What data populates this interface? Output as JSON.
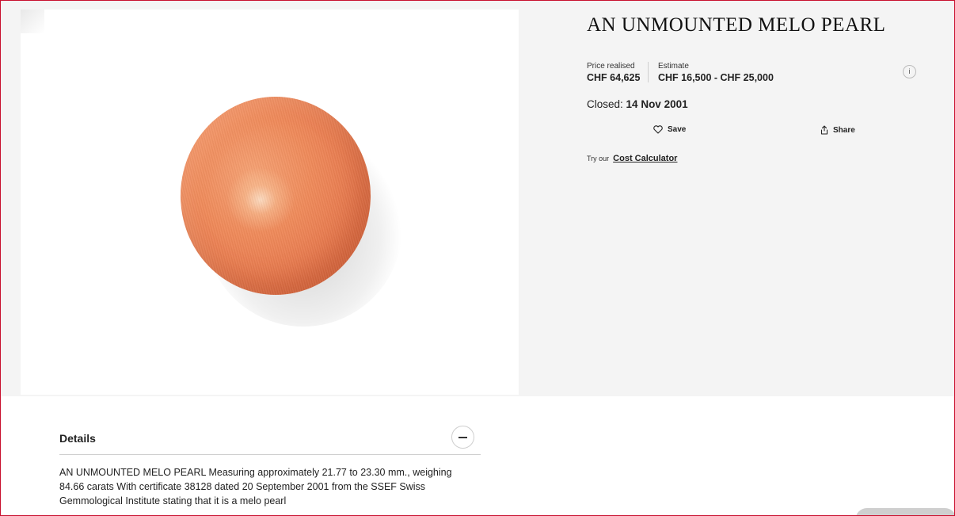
{
  "lot": {
    "title": "AN UNMOUNTED MELO PEARL",
    "image_alt": "Orange melo pearl on white background"
  },
  "pricing": {
    "price_label": "Price realised",
    "price_value": "CHF 64,625",
    "estimate_label": "Estimate",
    "estimate_value": "CHF 16,500 - CHF 25,000",
    "info_label": "i"
  },
  "status": {
    "closed_label": "Closed:",
    "closed_date": "14 Nov 2001"
  },
  "actions": {
    "save_label": "Save",
    "share_label": "Share",
    "save_icon": "heart-icon",
    "share_icon": "share-icon"
  },
  "calculator": {
    "prefix": "Try our",
    "link_label": "Cost Calculator"
  },
  "details": {
    "heading": "Details",
    "body": "AN UNMOUNTED MELO PEARL Measuring approximately 21.77 to 23.30 mm., weighing 84.66 carats With certificate 38128 dated 20 September 2001 from the SSEF Swiss Gemmological Institute stating that it is a melo pearl"
  },
  "colors": {
    "frame": "#c8102e",
    "band": "#f4f4f4",
    "pearl": "#ef8a5a"
  }
}
